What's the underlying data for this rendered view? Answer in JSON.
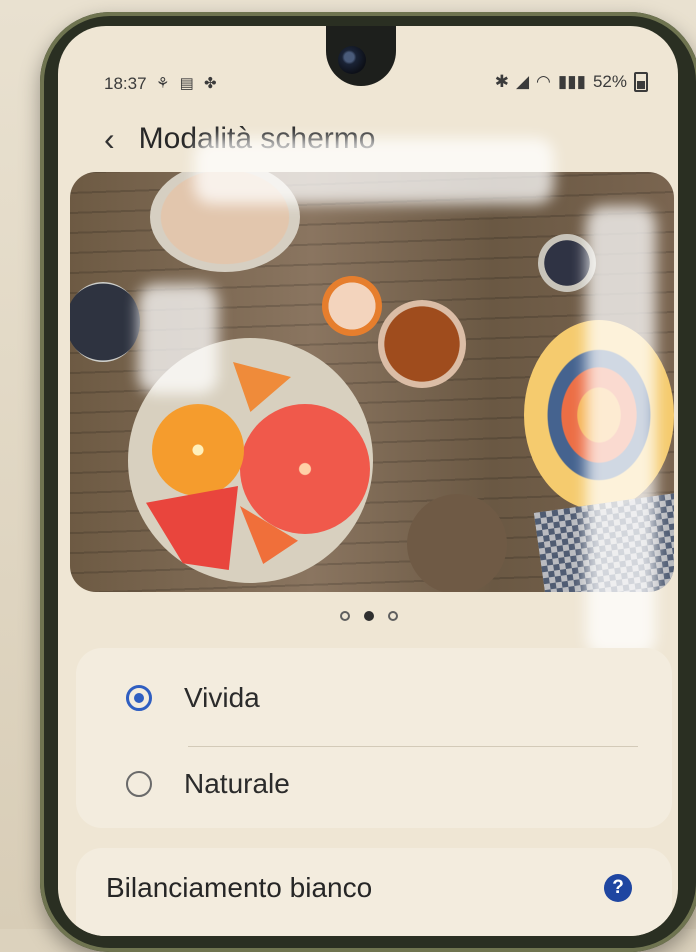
{
  "status_bar": {
    "time": "18:37",
    "battery": "52%"
  },
  "header": {
    "title": "Modalità schermo"
  },
  "display_modes": {
    "options": [
      {
        "label": "Vivida",
        "selected": true
      },
      {
        "label": "Naturale",
        "selected": false
      }
    ]
  },
  "white_balance": {
    "label": "Bilanciamento bianco"
  },
  "pager": {
    "current": 2,
    "total": 3
  },
  "colors": {
    "accent": "#2f5ec1",
    "help_icon": "#1f46a1"
  }
}
